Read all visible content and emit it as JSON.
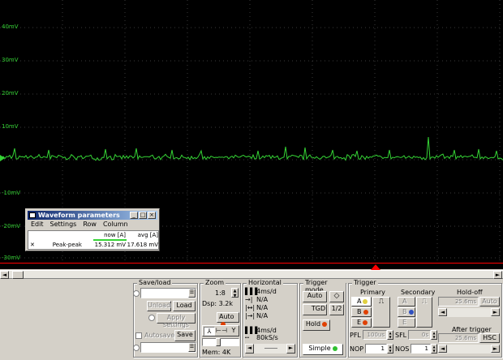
{
  "scope": {
    "y_labels": [
      "40mV",
      "30mV",
      "20mV",
      "10mV",
      "-10mV",
      "-20mV",
      "-30mV"
    ],
    "trace_color": "#35d335",
    "trigger_color": "#ff0000"
  },
  "waveform_params": {
    "title": "Waveform parameters",
    "menu": [
      "Edit",
      "Settings",
      "Row",
      "Column"
    ],
    "col_headers": [
      "now [A]",
      "avg [A]"
    ],
    "rows": [
      {
        "remove": "✕",
        "name": "Peak-peak",
        "now": "15.312 mV",
        "avg": "17.618 mV"
      }
    ]
  },
  "saveload": {
    "title": "Save/load",
    "unload": "Unload",
    "load": "Load",
    "apply": "Apply settings",
    "autosave": "Autosave",
    "save": "Save"
  },
  "zoom": {
    "title": "Zoom",
    "ratio": "1:8",
    "dsp": "Dsp: 3.2k",
    "auto": "Auto",
    "mem": "Mem: 4K"
  },
  "horizontal": {
    "title": "Horizontal",
    "rows": [
      "4ms/d",
      "N/A",
      "N/A",
      "N/A"
    ],
    "bottom_rows": [
      "4ms/d",
      "80kS/s"
    ]
  },
  "trigger_mode": {
    "title": "Trigger mode",
    "auto": "Auto",
    "tgd": "TGD",
    "half": "1/2",
    "hold": "Hold",
    "simple": "Simple"
  },
  "trigger": {
    "title": "Trigger",
    "primary": "Primary",
    "secondary": "Secondary",
    "holdoff": "Hold-off",
    "holdoff_value": "25.6ms",
    "holdoff_auto": "Auto",
    "prim_channels": [
      "A",
      "B",
      "E"
    ],
    "sec_channels": [
      "A",
      "B",
      "E"
    ],
    "pfl": "PFL",
    "pfl_value": "100us",
    "sfl": "SFL",
    "sfl_value": "0s",
    "nop": "NOP",
    "nop_value": "1",
    "nos": "NOS",
    "nos_value": "1",
    "after_trigger": "After trigger",
    "after_value": "25.6ms",
    "hsc": "HSC"
  }
}
